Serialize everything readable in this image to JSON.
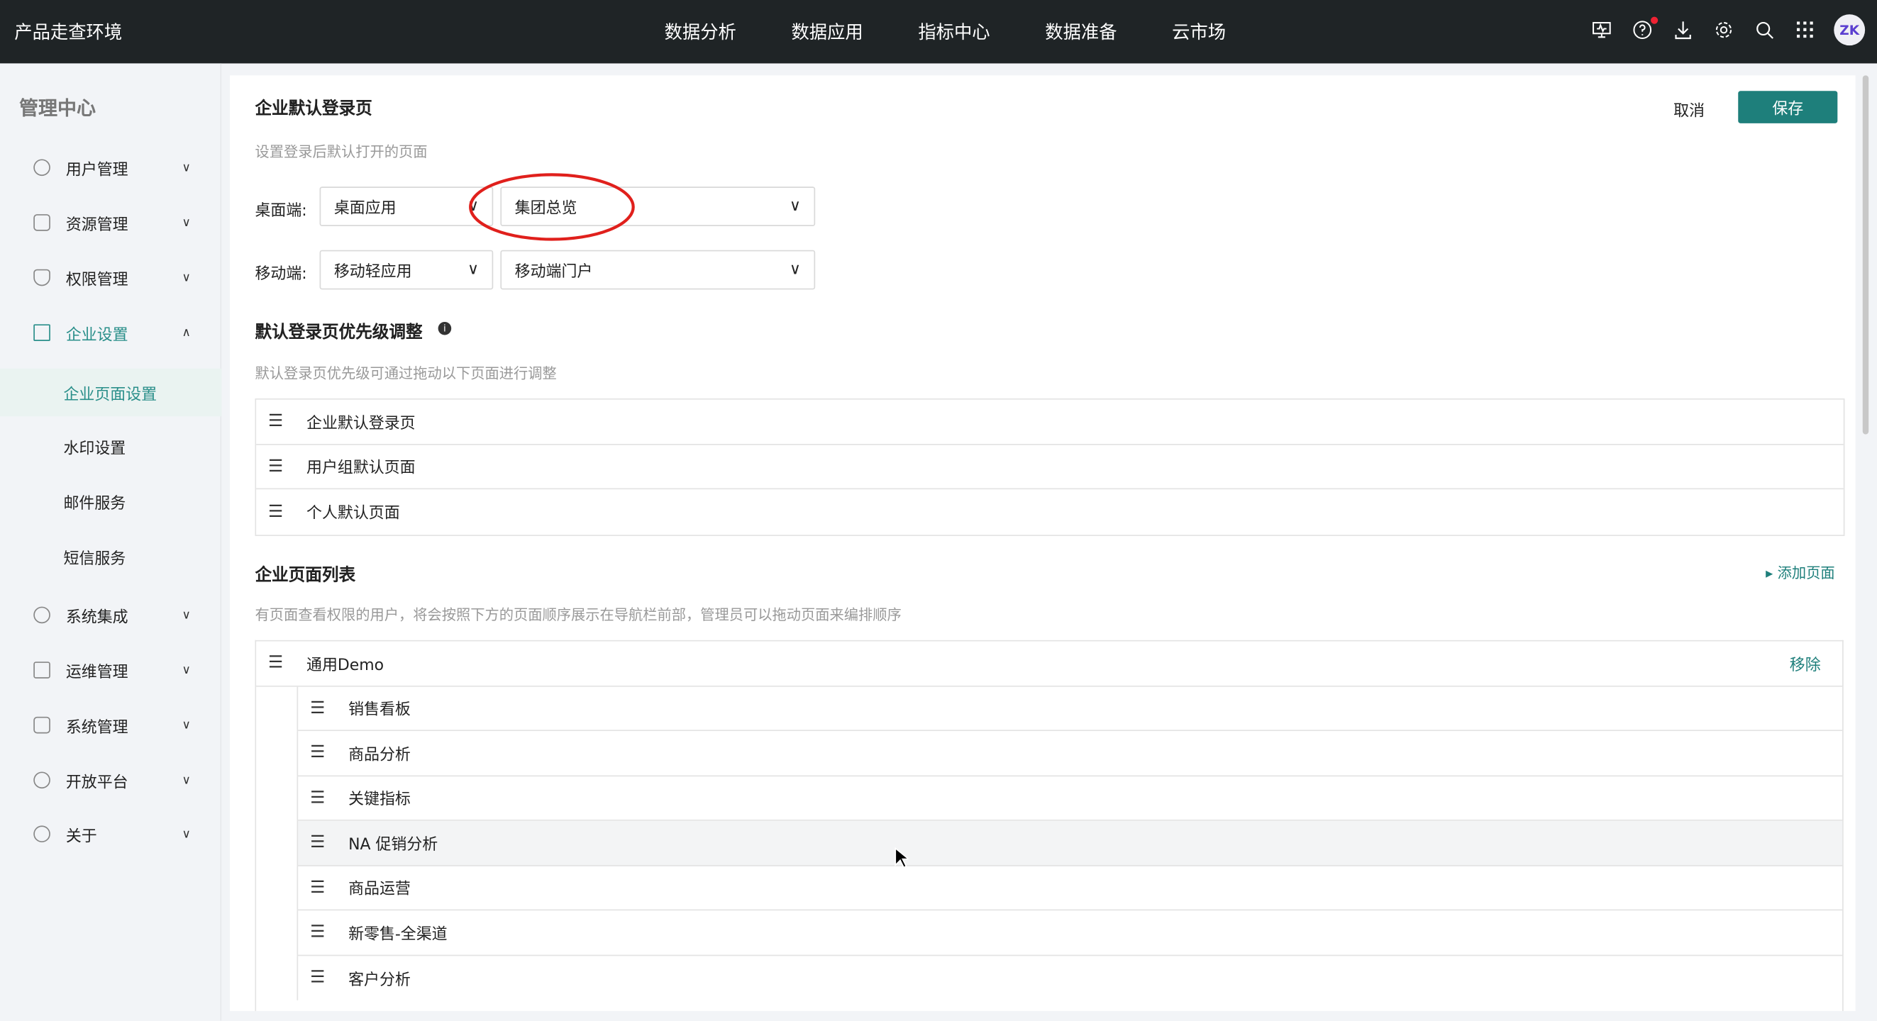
{
  "header": {
    "title": "产品走查环境",
    "nav": [
      "数据分析",
      "数据应用",
      "指标中心",
      "数据准备",
      "云市场"
    ],
    "avatar_text": "ZK",
    "icons": [
      "monitor-icon",
      "help-icon",
      "download-icon",
      "gear-icon",
      "search-icon",
      "apps-grid-icon"
    ]
  },
  "sidebar": {
    "title": "管理中心",
    "items": [
      {
        "label": "用户管理",
        "icon": "user-icon"
      },
      {
        "label": "资源管理",
        "icon": "grid-icon"
      },
      {
        "label": "权限管理",
        "icon": "shield-icon"
      },
      {
        "label": "企业设置",
        "icon": "building-icon",
        "expanded": true
      },
      {
        "label": "系统集成",
        "icon": "integration-icon"
      },
      {
        "label": "运维管理",
        "icon": "monitor-icon"
      },
      {
        "label": "系统管理",
        "icon": "system-icon"
      },
      {
        "label": "开放平台",
        "icon": "platform-icon"
      },
      {
        "label": "关于",
        "icon": "info-icon"
      }
    ],
    "subitems": [
      "企业页面设置",
      "水印设置",
      "邮件服务",
      "短信服务"
    ],
    "active_sub": "企业页面设置"
  },
  "main": {
    "title": "企业默认登录页",
    "cancel": "取消",
    "save": "保存",
    "desc": "设置登录后默认打开的页面",
    "desktop": {
      "label": "桌面端:",
      "type": "桌面应用",
      "page": "集团总览"
    },
    "mobile": {
      "label": "移动端:",
      "type": "移动轻应用",
      "page": "移动端门户"
    },
    "priority": {
      "title": "默认登录页优先级调整",
      "desc": "默认登录页优先级可通过拖动以下页面进行调整",
      "items": [
        "企业默认登录页",
        "用户组默认页面",
        "个人默认页面"
      ]
    },
    "pages": {
      "title": "企业页面列表",
      "add": "添加页面",
      "desc": "有页面查看权限的用户，将会按照下方的页面顺序展示在导航栏前部，管理员可以拖动页面来编排顺序",
      "group": "通用Demo",
      "remove": "移除",
      "children": [
        "销售看板",
        "商品分析",
        "关键指标",
        "NA 促销分析",
        "商品运营",
        "新零售-全渠道",
        "客户分析"
      ]
    }
  },
  "colors": {
    "accent": "#1e7f7b",
    "topbar": "#1f2426",
    "annotation": "#e0201c"
  }
}
